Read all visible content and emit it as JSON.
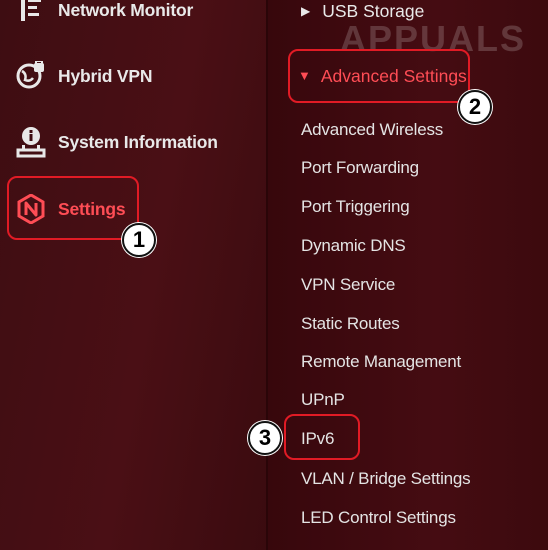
{
  "sidebar": {
    "items": [
      {
        "label": "Network Monitor",
        "icon": "network-monitor-icon"
      },
      {
        "label": "Hybrid VPN",
        "icon": "vpn-globe-icon"
      },
      {
        "label": "System Information",
        "icon": "system-info-icon"
      },
      {
        "label": "Settings",
        "icon": "settings-n-icon",
        "active": true
      }
    ]
  },
  "submenu": {
    "usb_storage": "USB Storage",
    "advanced_settings": "Advanced Settings",
    "items": [
      "Advanced Wireless",
      "Port Forwarding",
      "Port Triggering",
      "Dynamic DNS",
      "VPN Service",
      "Static Routes",
      "Remote Management",
      "UPnP",
      "IPv6",
      "VLAN / Bridge Settings",
      "LED Control Settings"
    ]
  },
  "steps": [
    "1",
    "2",
    "3"
  ],
  "watermark": "APPUALS",
  "colors": {
    "accent": "#e11b25",
    "active_text": "#ff4d55",
    "background": "#3a0b0e"
  }
}
